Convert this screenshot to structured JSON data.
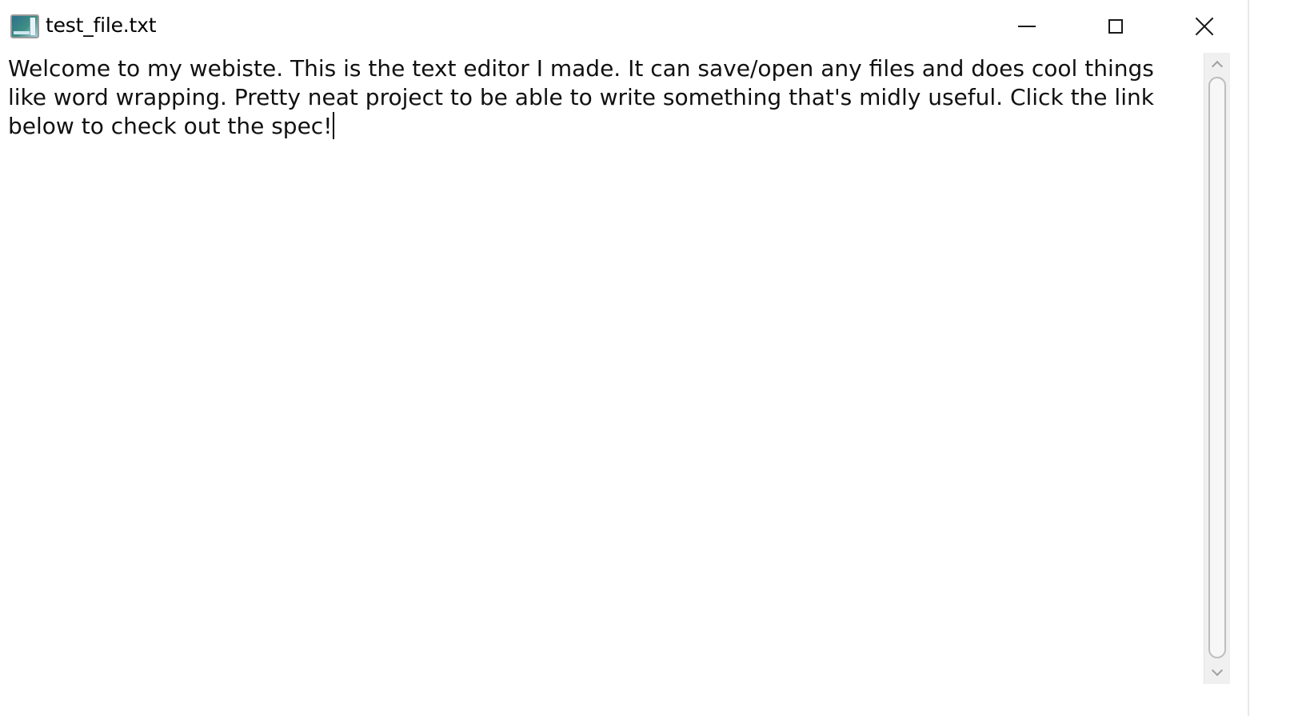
{
  "window": {
    "title": "test_file.txt",
    "icon": "app-icon",
    "controls": {
      "minimize_icon": "minimize-icon",
      "maximize_icon": "maximize-icon",
      "close_icon": "close-icon"
    }
  },
  "editor": {
    "text": "Welcome to my webiste. This is the text editor I made. It can save/open any files and does cool things like word wrapping. Pretty neat project to be able to write something that's midly useful. Click the link below to check out the spec!"
  },
  "scrollbar": {
    "up_icon": "chevron-up-icon",
    "down_icon": "chevron-down-icon"
  }
}
